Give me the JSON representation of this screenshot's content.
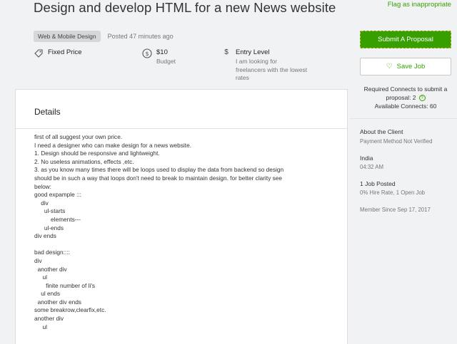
{
  "job": {
    "title": "Design and develop HTML for a new News website",
    "flag_label": "Flag as inappropriate",
    "category": "Web & Mobile Design",
    "posted": "Posted 47 minutes ago"
  },
  "info": {
    "price_type": "Fixed Price",
    "budget_value": "$10",
    "budget_label": "Budget",
    "level_label": "Entry Level",
    "level_desc": [
      "I am looking for",
      "freelancers with the lowest",
      "rates"
    ]
  },
  "details": {
    "heading": "Details",
    "lines": [
      "first of all suggest your own price.",
      "I need a designer who can make design for a news website.",
      "1. Design should be responsive and lightweight.",
      "2. No useless animations, effects ,etc.",
      "3. as you know many times there will be loops used to display the data from backend so design",
      "should be in such a way that loops don't need to break to maintain design. for better clarity see",
      "below:",
      "good expample :::",
      "    div",
      "      ul-starts",
      "          elements---",
      "      ul-ends",
      "div ends",
      "",
      "bad design::::",
      "div",
      "  another div",
      "     ul",
      "       finite number of li's",
      "    ul ends",
      "  another div ends",
      "some breakrow,clearfix,etc.",
      "another div",
      "     ul"
    ]
  },
  "sidebar": {
    "submit_label": "Submit A Proposal",
    "save_label": "Save Job",
    "connects_line1": "Required Connects to submit a",
    "connects_line2": "proposal: 2",
    "connects_line3": "Available Connects: 60",
    "about_heading": "About the Client",
    "payment": "Payment Method Not Verified",
    "country": "India",
    "time": "04:32 AM",
    "jobs_posted": "1 Job Posted",
    "hire_rate": "0% Hire Rate, 1 Open Job",
    "member_since": "Member Since Sep 17, 2017"
  },
  "colors": {
    "accent": "#37a000"
  }
}
